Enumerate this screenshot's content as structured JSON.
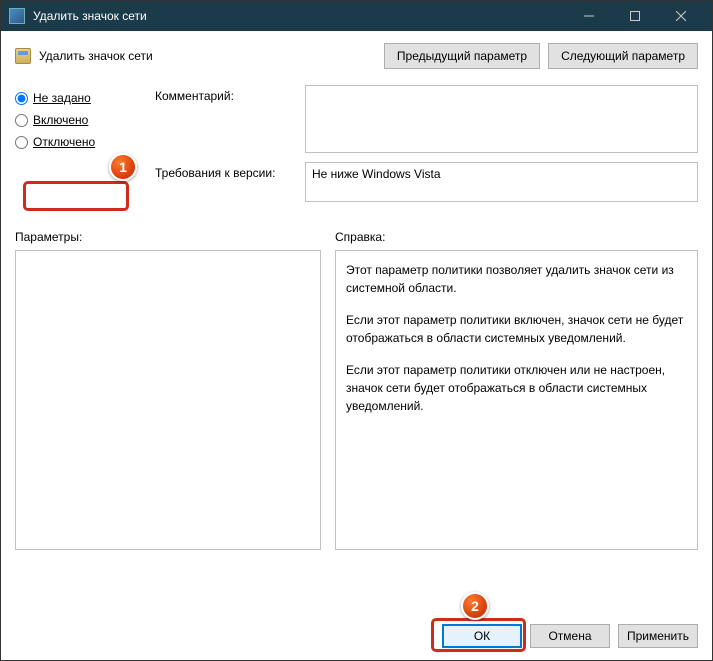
{
  "titlebar": {
    "title": "Удалить значок сети"
  },
  "header": {
    "policy_title": "Удалить значок сети",
    "prev_label": "Предыдущий параметр",
    "next_label": "Следующий параметр"
  },
  "radios": {
    "not_configured": "Не задано",
    "enabled": "Включено",
    "disabled": "Отключено"
  },
  "labels": {
    "comment": "Комментарий:",
    "requirements": "Требования к версии:",
    "params": "Параметры:",
    "help": "Справка:"
  },
  "fields": {
    "comment_value": "",
    "requirements_value": "Не ниже Windows Vista"
  },
  "help": {
    "p1": "Этот параметр политики позволяет удалить значок сети из системной области.",
    "p2": "Если этот параметр политики включен, значок сети не будет отображаться в области системных уведомлений.",
    "p3": "Если этот параметр политики отключен или не настроен, значок сети будет отображаться в области системных уведомлений."
  },
  "buttons": {
    "ok": "ОК",
    "cancel": "Отмена",
    "apply": "Применить"
  },
  "annotations": {
    "step1": "1",
    "step2": "2"
  }
}
